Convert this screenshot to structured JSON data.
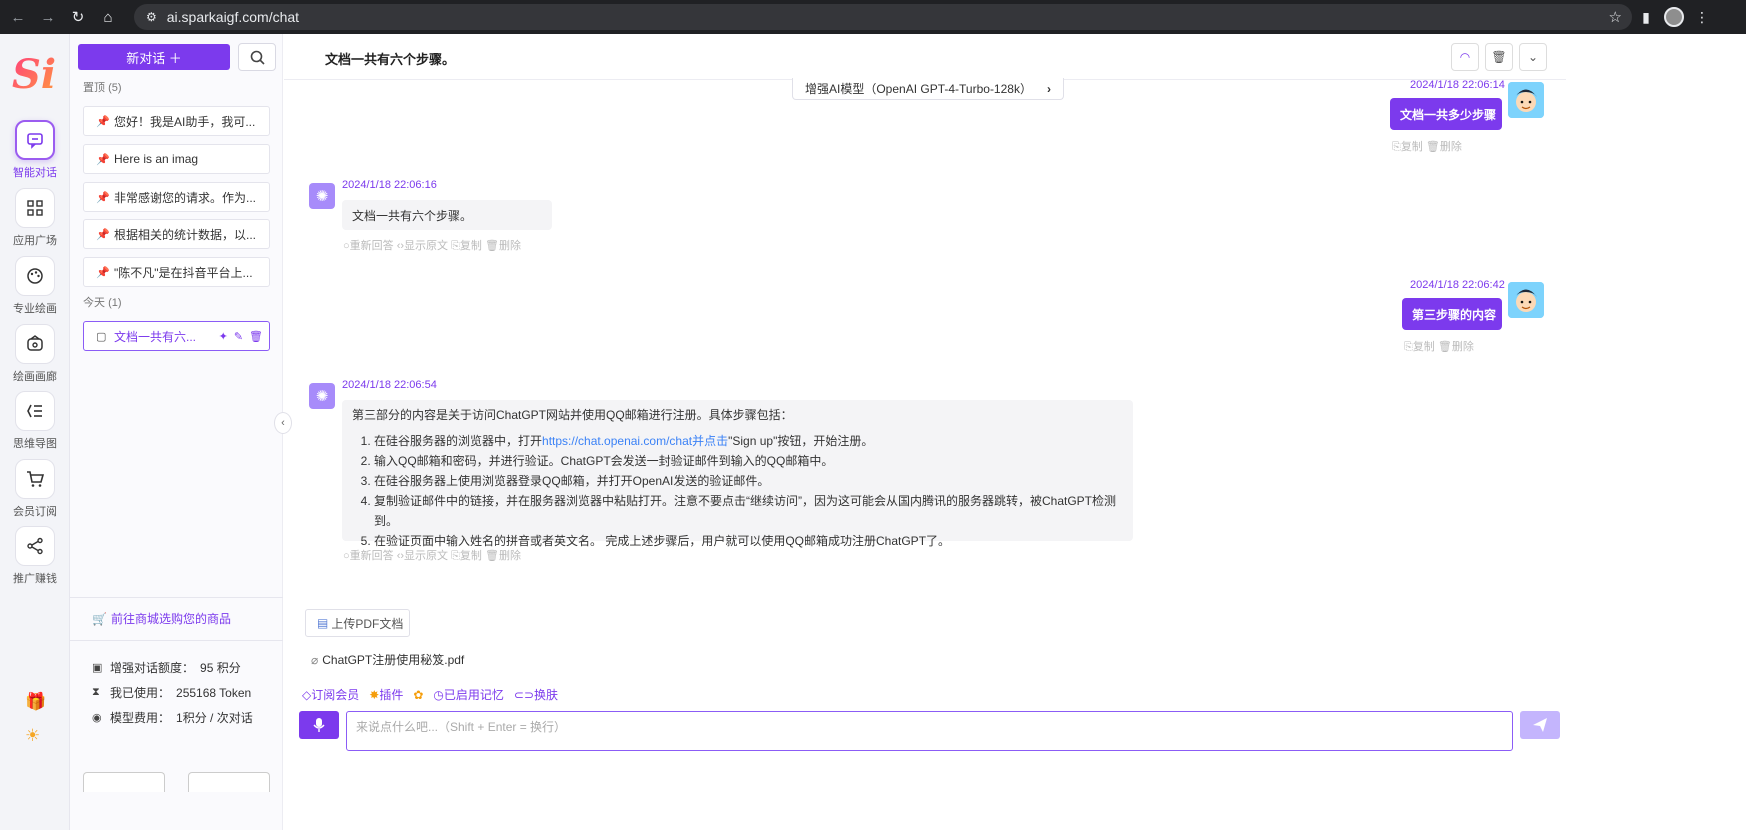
{
  "browser": {
    "url": "ai.sparkaigf.com/chat"
  },
  "rail": {
    "logo_text": "Si",
    "items": [
      {
        "label": "智能对话",
        "icon": "chat-icon"
      },
      {
        "label": "应用广场",
        "icon": "apps-icon"
      },
      {
        "label": "专业绘画",
        "icon": "palette-icon"
      },
      {
        "label": "绘画画廊",
        "icon": "gallery-icon"
      },
      {
        "label": "思维导图",
        "icon": "mindmap-icon"
      },
      {
        "label": "会员订阅",
        "icon": "cart-icon"
      },
      {
        "label": "推广赚钱",
        "icon": "share-icon"
      }
    ]
  },
  "sidebar": {
    "new_chat": "新对话 ＋",
    "pinned_title": "置顶",
    "pinned_count": "(5)",
    "pinned": [
      "您好！我是AI助手，我可...",
      "Here is an imag",
      "非常感谢您的请求。作为...",
      "根据相关的统计数据，以...",
      "\"陈不凡\"是在抖音平台上..."
    ],
    "today_title": "今天",
    "today_count": "(1)",
    "today": [
      "文档一共有六..."
    ],
    "shop_link": "前往商城选购您的商品",
    "stats": {
      "enhanced_label": "增强对话额度：",
      "enhanced_value": "95 积分",
      "used_label": "我已使用：",
      "used_value": "255168 Token",
      "cost_label": "模型费用：",
      "cost_value": "1积分 / 次对话"
    }
  },
  "main": {
    "title": "文档一共有六个步骤。",
    "model": "增强AI模型（OpenAI GPT-4-Turbo-128k）",
    "messages": {
      "u1_time": "2024/1/18 22:06:14",
      "u1_text": "文档一共多少步骤",
      "u1_copy": "复制",
      "u1_delete": "删除",
      "a1_time": "2024/1/18 22:06:16",
      "a1_text": "文档一共有六个步骤。",
      "a1_regen": "重新回答",
      "a1_raw": "显示原文",
      "a1_copy": "复制",
      "a1_delete": "删除",
      "u2_time": "2024/1/18 22:06:42",
      "u2_text": "第三步骤的内容",
      "u2_copy": "复制",
      "u2_delete": "删除",
      "a2_time": "2024/1/18 22:06:54",
      "a2_intro": "第三部分的内容是关于访问ChatGPT网站并使用QQ邮箱进行注册。具体步骤包括：",
      "a2_step1_pre": "在硅谷服务器的浏览器中，打开",
      "a2_step1_link": "https://chat.openai.com/chat并点击",
      "a2_step1_post": "\"Sign up\"按钮，开始注册。",
      "a2_step2": "输入QQ邮箱和密码，并进行验证。ChatGPT会发送一封验证邮件到输入的QQ邮箱中。",
      "a2_step3": "在硅谷服务器上使用浏览器登录QQ邮箱，并打开OpenAI发送的验证邮件。",
      "a2_step4": "复制验证邮件中的链接，并在服务器浏览器中粘贴打开。注意不要点击“继续访问”，因为这可能会从国内腾讯的服务器跳转，被ChatGPT检测到。",
      "a2_step5": "在验证页面中输入姓名的拼音或者英文名。 完成上述步骤后，用户就可以使用QQ邮箱成功注册ChatGPT了。",
      "a2_regen": "重新回答",
      "a2_raw": "显示原文",
      "a2_copy": "复制",
      "a2_delete": "删除"
    },
    "upload_pdf": "上传PDF文档",
    "attached_file": "ChatGPT注册使用秘笈.pdf",
    "tools": {
      "subscribe": "订阅会员",
      "plugins": "插件",
      "memory": "已启用记忆",
      "skin": "换肤"
    },
    "input_placeholder": "来说点什么吧...（Shift + Enter = 换行）"
  }
}
